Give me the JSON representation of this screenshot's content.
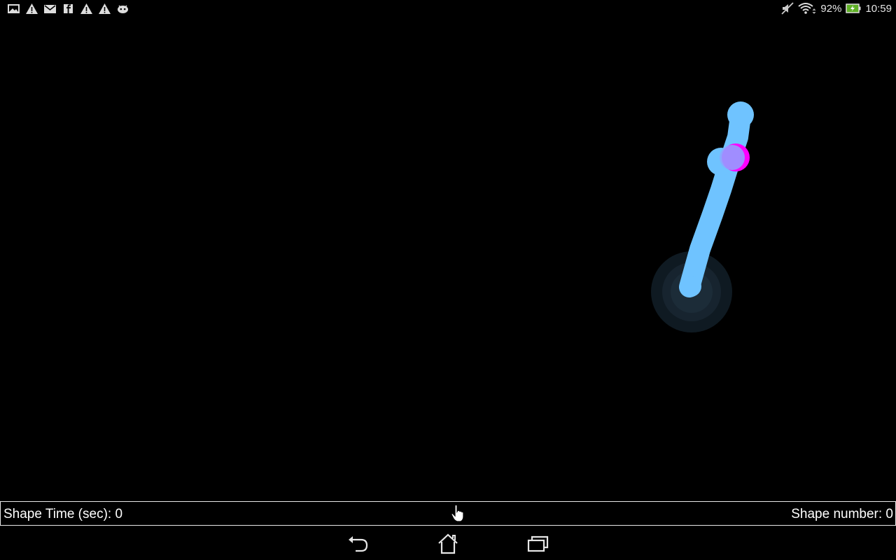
{
  "status_bar": {
    "notification_icons": [
      "gallery-icon",
      "warning-icon",
      "gmail-icon",
      "facebook-icon",
      "warning-icon",
      "warning-icon",
      "android-icon"
    ],
    "battery_percent": "92%",
    "time": "10:59"
  },
  "canvas": {
    "stroke_color": "#6fc3ff",
    "marker_color": "#ff00ff",
    "touch_ring_color": "#1b2a36"
  },
  "info_bar": {
    "shape_time_label": "Shape Time (sec): 0",
    "shape_number_label": "Shape number: 0"
  },
  "nav_bar": {
    "buttons": [
      "back-icon",
      "home-icon",
      "recent-apps-icon"
    ]
  }
}
